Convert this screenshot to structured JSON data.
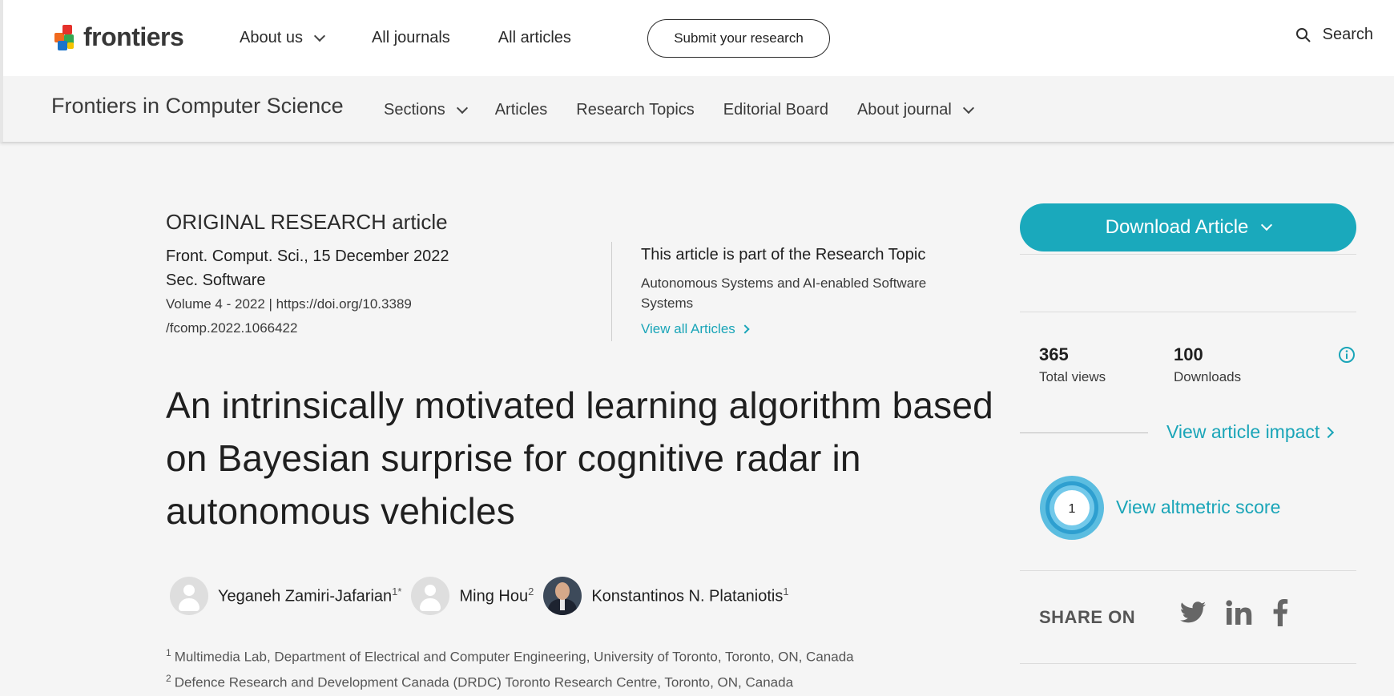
{
  "header": {
    "logo_text": "frontiers",
    "nav": [
      {
        "label": "About us"
      },
      {
        "label": "All journals"
      },
      {
        "label": "All articles"
      }
    ],
    "submit_label": "Submit your research",
    "search_label": "Search"
  },
  "journal": {
    "title": "Frontiers in Computer Science",
    "nav": [
      {
        "label": "Sections"
      },
      {
        "label": "Articles"
      },
      {
        "label": "Research Topics"
      },
      {
        "label": "Editorial Board"
      },
      {
        "label": "About journal"
      }
    ]
  },
  "article": {
    "type": "ORIGINAL RESEARCH article",
    "citation": "Front. Comput. Sci., 15 December 2022",
    "section": "Sec. Software",
    "volume_doi": "Volume 4 - 2022 | https://doi.org/10.3389 /fcomp.2022.1066422",
    "research_topic_heading": "This article is part of the Research Topic",
    "research_topic_name": "Autonomous Systems and AI-enabled Software Systems",
    "view_all_label": "View all Articles",
    "title": "An intrinsically motivated learning algorithm based on Bayesian surprise for cognitive radar in autonomous vehicles",
    "authors": [
      {
        "name": "Yeganeh Zamiri-Jafarian",
        "sup": "1*"
      },
      {
        "name": "Ming Hou",
        "sup": "2"
      },
      {
        "name": "Konstantinos N. Plataniotis",
        "sup": "1"
      }
    ],
    "affiliations": [
      {
        "num": "1",
        "text": "Multimedia Lab, Department of Electrical and Computer Engineering, University of Toronto, Toronto, ON, Canada"
      },
      {
        "num": "2",
        "text": "Defence Research and Development Canada (DRDC) Toronto Research Centre, Toronto, ON, Canada"
      }
    ]
  },
  "sidebar": {
    "download_label": "Download Article",
    "views_count": "365",
    "views_label": "Total views",
    "downloads_count": "100",
    "downloads_label": "Downloads",
    "impact_label": "View article impact",
    "altmetric_score": "1",
    "altmetric_label": "View altmetric score",
    "share_label": "SHARE ON",
    "share_icons": [
      "twitter-icon",
      "linkedin-icon",
      "facebook-icon"
    ]
  },
  "colors": {
    "accent": "#1aa9bc",
    "link": "#1aa5b8",
    "page_bg": "#f5f5f5"
  }
}
